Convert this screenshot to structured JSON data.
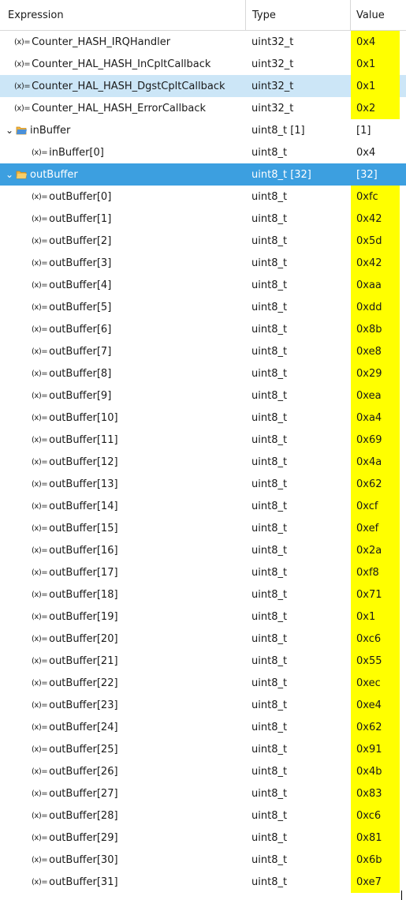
{
  "header": {
    "expression": "Expression",
    "type": "Type",
    "value": "Value"
  },
  "icons": {
    "variable": "variable-icon",
    "folder": "folder-icon",
    "expand": "chevron-down-icon"
  },
  "colors": {
    "highlight": "#ffff00",
    "selected": "#3c9fe0",
    "hover": "#cce6f7"
  },
  "var_prefix": "(x)=",
  "rows": [
    {
      "expr": "Counter_HASH_IRQHandler",
      "type": "uint32_t",
      "value": "0x4"
    },
    {
      "expr": "Counter_HAL_HASH_InCpltCallback",
      "type": "uint32_t",
      "value": "0x1"
    },
    {
      "expr": "Counter_HAL_HASH_DgstCpltCallback",
      "type": "uint32_t",
      "value": "0x1"
    },
    {
      "expr": "Counter_HAL_HASH_ErrorCallback",
      "type": "uint32_t",
      "value": "0x2"
    },
    {
      "expr": "inBuffer",
      "type": "uint8_t [1]",
      "value": "[1]"
    },
    {
      "expr": "inBuffer[0]",
      "type": "uint8_t",
      "value": "0x4"
    },
    {
      "expr": "outBuffer",
      "type": "uint8_t [32]",
      "value": "[32]"
    },
    {
      "expr": "outBuffer[0]",
      "type": "uint8_t",
      "value": "0xfc"
    },
    {
      "expr": "outBuffer[1]",
      "type": "uint8_t",
      "value": "0x42"
    },
    {
      "expr": "outBuffer[2]",
      "type": "uint8_t",
      "value": "0x5d"
    },
    {
      "expr": "outBuffer[3]",
      "type": "uint8_t",
      "value": "0x42"
    },
    {
      "expr": "outBuffer[4]",
      "type": "uint8_t",
      "value": "0xaa"
    },
    {
      "expr": "outBuffer[5]",
      "type": "uint8_t",
      "value": "0xdd"
    },
    {
      "expr": "outBuffer[6]",
      "type": "uint8_t",
      "value": "0x8b"
    },
    {
      "expr": "outBuffer[7]",
      "type": "uint8_t",
      "value": "0xe8"
    },
    {
      "expr": "outBuffer[8]",
      "type": "uint8_t",
      "value": "0x29"
    },
    {
      "expr": "outBuffer[9]",
      "type": "uint8_t",
      "value": "0xea"
    },
    {
      "expr": "outBuffer[10]",
      "type": "uint8_t",
      "value": "0xa4"
    },
    {
      "expr": "outBuffer[11]",
      "type": "uint8_t",
      "value": "0x69"
    },
    {
      "expr": "outBuffer[12]",
      "type": "uint8_t",
      "value": "0x4a"
    },
    {
      "expr": "outBuffer[13]",
      "type": "uint8_t",
      "value": "0x62"
    },
    {
      "expr": "outBuffer[14]",
      "type": "uint8_t",
      "value": "0xcf"
    },
    {
      "expr": "outBuffer[15]",
      "type": "uint8_t",
      "value": "0xef"
    },
    {
      "expr": "outBuffer[16]",
      "type": "uint8_t",
      "value": "0x2a"
    },
    {
      "expr": "outBuffer[17]",
      "type": "uint8_t",
      "value": "0xf8"
    },
    {
      "expr": "outBuffer[18]",
      "type": "uint8_t",
      "value": "0x71"
    },
    {
      "expr": "outBuffer[19]",
      "type": "uint8_t",
      "value": "0x1"
    },
    {
      "expr": "outBuffer[20]",
      "type": "uint8_t",
      "value": "0xc6"
    },
    {
      "expr": "outBuffer[21]",
      "type": "uint8_t",
      "value": "0x55"
    },
    {
      "expr": "outBuffer[22]",
      "type": "uint8_t",
      "value": "0xec"
    },
    {
      "expr": "outBuffer[23]",
      "type": "uint8_t",
      "value": "0xe4"
    },
    {
      "expr": "outBuffer[24]",
      "type": "uint8_t",
      "value": "0x62"
    },
    {
      "expr": "outBuffer[25]",
      "type": "uint8_t",
      "value": "0x91"
    },
    {
      "expr": "outBuffer[26]",
      "type": "uint8_t",
      "value": "0x4b"
    },
    {
      "expr": "outBuffer[27]",
      "type": "uint8_t",
      "value": "0x83"
    },
    {
      "expr": "outBuffer[28]",
      "type": "uint8_t",
      "value": "0xc6"
    },
    {
      "expr": "outBuffer[29]",
      "type": "uint8_t",
      "value": "0x81"
    },
    {
      "expr": "outBuffer[30]",
      "type": "uint8_t",
      "value": "0x6b"
    },
    {
      "expr": "outBuffer[31]",
      "type": "uint8_t",
      "value": "0xe7"
    }
  ]
}
